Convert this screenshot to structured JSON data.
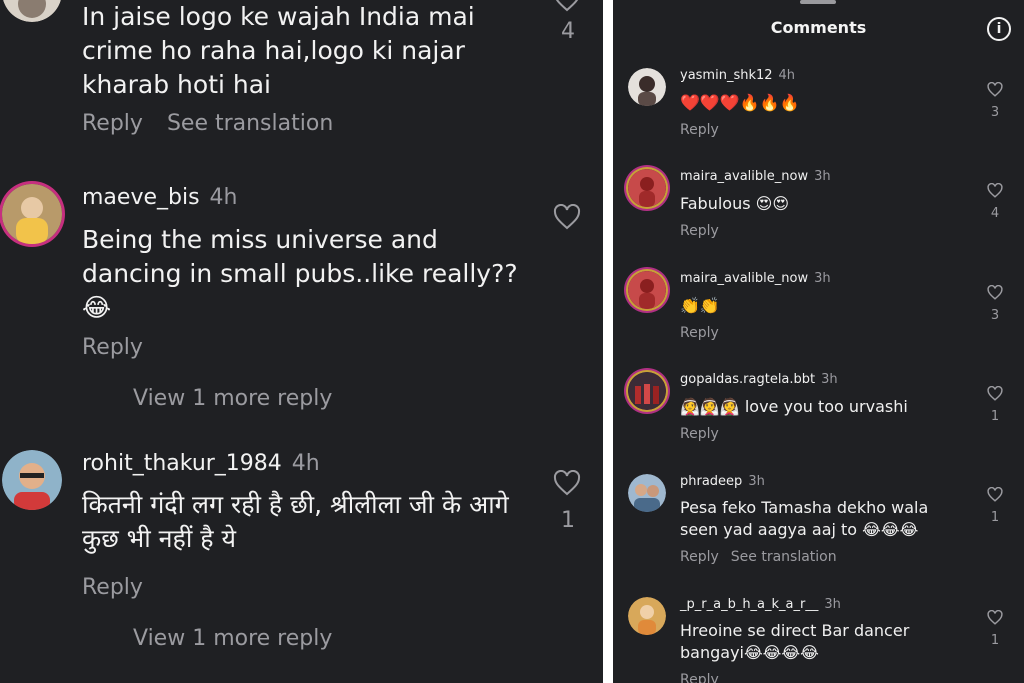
{
  "left": {
    "comments": [
      {
        "username": "",
        "time": "",
        "text": "In jaise logo ke wajah India mai crime ho raha hai,logo ki najar kharab hoti hai",
        "actions": [
          "Reply",
          "See translation"
        ],
        "likes": "4"
      },
      {
        "username": "maeve_bis",
        "time": "4h",
        "text": "Being the miss universe and dancing in small pubs..like really?? 😂",
        "actions": [
          "Reply"
        ],
        "view_more": "View 1 more reply",
        "likes": ""
      },
      {
        "username": "rohit_thakur_1984",
        "time": "4h",
        "text": "कितनी गंदी लग रही है छी, श्रीलीला जी के आगे कुछ भी नहीं है ये",
        "actions": [
          "Reply"
        ],
        "view_more": "View 1 more reply",
        "likes": "1"
      }
    ]
  },
  "right": {
    "title": "Comments",
    "info_icon": "i",
    "comments": [
      {
        "username": "yasmin_shk12",
        "time": "4h",
        "text": "❤️❤️❤️🔥🔥🔥",
        "actions": [
          "Reply"
        ],
        "likes": "3"
      },
      {
        "username": "maira_avalible_now",
        "time": "3h",
        "text": "Fabulous 😍😍",
        "actions": [
          "Reply"
        ],
        "likes": "4"
      },
      {
        "username": "maira_avalible_now",
        "time": "3h",
        "text": "👏👏",
        "actions": [
          "Reply"
        ],
        "likes": "3"
      },
      {
        "username": "gopaldas.ragtela.bbt",
        "time": "3h",
        "text": "👰👰👰 love you too urvashi",
        "actions": [
          "Reply"
        ],
        "likes": "1"
      },
      {
        "username": "phradeep",
        "time": "3h",
        "text": "Pesa feko Tamasha dekho wala seen yad aagya aaj to 😂😂😂",
        "actions": [
          "Reply",
          "See translation"
        ],
        "likes": "1"
      },
      {
        "username": "_p_r_a_b_h_a_k_a_r__",
        "time": "3h",
        "text": "Hreoine se direct Bar dancer bangayi😂😂😂😂",
        "actions": [
          "Reply"
        ],
        "likes": "1"
      }
    ]
  },
  "colors": {
    "background": "#1f2023",
    "text": "#f2f2f2",
    "muted": "#9b9ba0",
    "story_ring": "#c62f7f"
  },
  "icons": {
    "heart": "heart-icon",
    "info": "info-icon",
    "avatar": "avatar"
  }
}
